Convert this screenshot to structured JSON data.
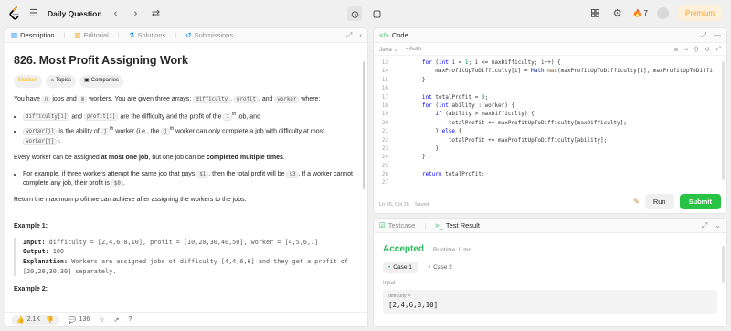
{
  "topbar": {
    "title": "Daily Question",
    "streak": "7",
    "premium": "Premium"
  },
  "left_tabs": [
    "Description",
    "Editorial",
    "Solutions",
    "Submissions"
  ],
  "problem": {
    "title": "826. Most Profit Assigning Work",
    "difficulty": "Medium",
    "tag_topics": "Topics",
    "tag_companies": "Companies",
    "intro_1": "You have ",
    "intro_n": "n",
    "intro_2": " jobs and ",
    "intro_m": "m",
    "intro_3": " workers. You are given three arrays: ",
    "arr_difficulty": "difficulty",
    "arr_profit": "profit",
    "arr_worker": "worker",
    "intro_4": ", and ",
    "intro_5": " where:",
    "b1_a": "difficulty[i]",
    "b1_b": " and ",
    "b1_c": "profit[i]",
    "b1_d": " are the difficulty and the profit of the ",
    "b1_e": "i",
    "b1_sup": "th",
    "b1_f": " job, and",
    "b2_a": "worker[j]",
    "b2_b": " is the ability of ",
    "b2_c": "j",
    "b2_sup": "th",
    "b2_d": " worker (i.e., the ",
    "b2_e": "j",
    "b2_sup2": "th",
    "b2_f": " worker can only complete a job with difficulty at most ",
    "b2_g": "worker[j]",
    "b2_h": ").",
    "p2_a": "Every worker can be assigned ",
    "p2_b": "at most one job",
    "p2_c": ", but one job can be ",
    "p2_d": "completed multiple times",
    "p2_e": ".",
    "b3_a": "For example, if three workers attempt the same job that pays ",
    "b3_b": "$1",
    "b3_c": ", then the total profit will be ",
    "b3_d": "$3",
    "b3_e": ". If a worker cannot complete any job, their profit is ",
    "b3_f": "$0",
    "b3_g": ".",
    "p3": "Return the maximum profit we can achieve after assigning the workers to the jobs.",
    "ex1_title": "Example 1:",
    "ex1_input_k": "Input:",
    "ex1_input_v": " difficulty = [2,4,6,8,10], profit = [10,20,30,40,50], worker = [4,5,6,7]",
    "ex1_output_k": "Output:",
    "ex1_output_v": " 100",
    "ex1_expl_k": "Explanation:",
    "ex1_expl_v": " Workers are assigned jobs of difficulty [4,4,6,6] and they get a profit of [20,20,30,30] separately.",
    "ex2_title": "Example 2:"
  },
  "footer": {
    "likes": "2.1K",
    "comments": "136"
  },
  "editor": {
    "tab": "Code",
    "language": "Java",
    "autosave": "Auto",
    "status": "Ln 26, Col 28",
    "saved": "Saved",
    "run": "Run",
    "submit": "Submit",
    "lines": [
      {
        "n": "13",
        "code": "        for (int i = 1; i <= maxDifficulty; i++) {"
      },
      {
        "n": "14",
        "code": "            maxProfitUpToDifficulty[i] = Math.max(maxProfitUpToDifficulty[i], maxProfitUpToDiffi"
      },
      {
        "n": "15",
        "code": "        }"
      },
      {
        "n": "16",
        "code": ""
      },
      {
        "n": "17",
        "code": "        int totalProfit = 0;"
      },
      {
        "n": "18",
        "code": "        for (int ability : worker) {"
      },
      {
        "n": "19",
        "code": "            if (ability > maxDifficulty) {"
      },
      {
        "n": "20",
        "code": "                totalProfit += maxProfitUpToDifficulty[maxDifficulty];"
      },
      {
        "n": "21",
        "code": "            } else {"
      },
      {
        "n": "22",
        "code": "                totalProfit += maxProfitUpToDifficulty[ability];"
      },
      {
        "n": "23",
        "code": "            }"
      },
      {
        "n": "24",
        "code": "        }"
      },
      {
        "n": "25",
        "code": ""
      },
      {
        "n": "26",
        "code": "        return totalProfit;"
      },
      {
        "n": "27",
        "code": ""
      }
    ]
  },
  "tests": {
    "tab_testcase": "Testcase",
    "tab_result": "Test Result",
    "result": "Accepted",
    "runtime": "Runtime: 0 ms",
    "case1": "Case 1",
    "case2": "Case 2",
    "input_label": "Input",
    "input_name": "difficulty =",
    "input_value": "[2,4,6,8,10]"
  },
  "colors": {
    "accepted": "#2cbb5d",
    "submit": "#28c244",
    "premium": "#ffa116",
    "medium": "#ffb800"
  }
}
